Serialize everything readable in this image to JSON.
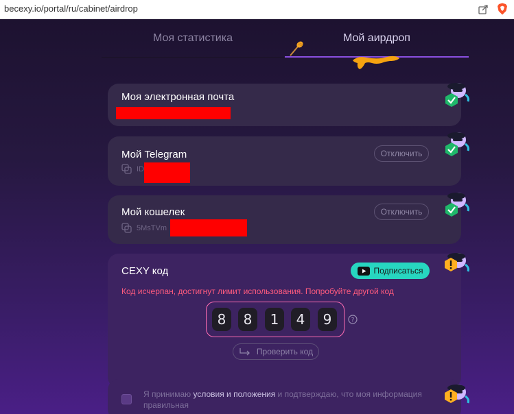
{
  "browser": {
    "url": "becexy.io/portal/ru/cabinet/airdrop"
  },
  "tabs": [
    {
      "label": "Моя статистика"
    },
    {
      "label": "Мой аирдроп"
    }
  ],
  "email_card": {
    "title": "Моя электронная почта"
  },
  "telegram_card": {
    "title": "Мой Telegram",
    "id_prefix": "ID",
    "disconnect_label": "Отключить"
  },
  "wallet_card": {
    "title": "Мой кошелек",
    "address_prefix": "5MsTVm",
    "disconnect_label": "Отключить"
  },
  "code_card": {
    "title": "CEXY код",
    "subscribe_label": "Подписаться",
    "error_text": "Код исчерпан, достигнут лимит использования. Попробуйте другой код",
    "digits": [
      "8",
      "8",
      "1",
      "4",
      "9"
    ],
    "help_glyph": "?",
    "verify_label": "Проверить код"
  },
  "terms": {
    "prefix": "Я принимаю ",
    "link_text": "условия и положения",
    "suffix": " и подтверждаю, что моя информация правильная",
    "checked": false
  },
  "colors": {
    "accent_purple": "#8a4fe0",
    "success_green": "#1fb86a",
    "warning_orange": "#ffb020",
    "error_pink": "#ff5b7e",
    "subscribe_teal": "#27d6c0",
    "redaction_red": "#ff0000"
  },
  "icons": [
    "share-icon",
    "brave-icon",
    "honey-dipper-icon",
    "copy-icon",
    "check-badge-icon",
    "warning-badge-icon",
    "youtube-icon",
    "help-icon",
    "redirect-arrow-icon"
  ]
}
